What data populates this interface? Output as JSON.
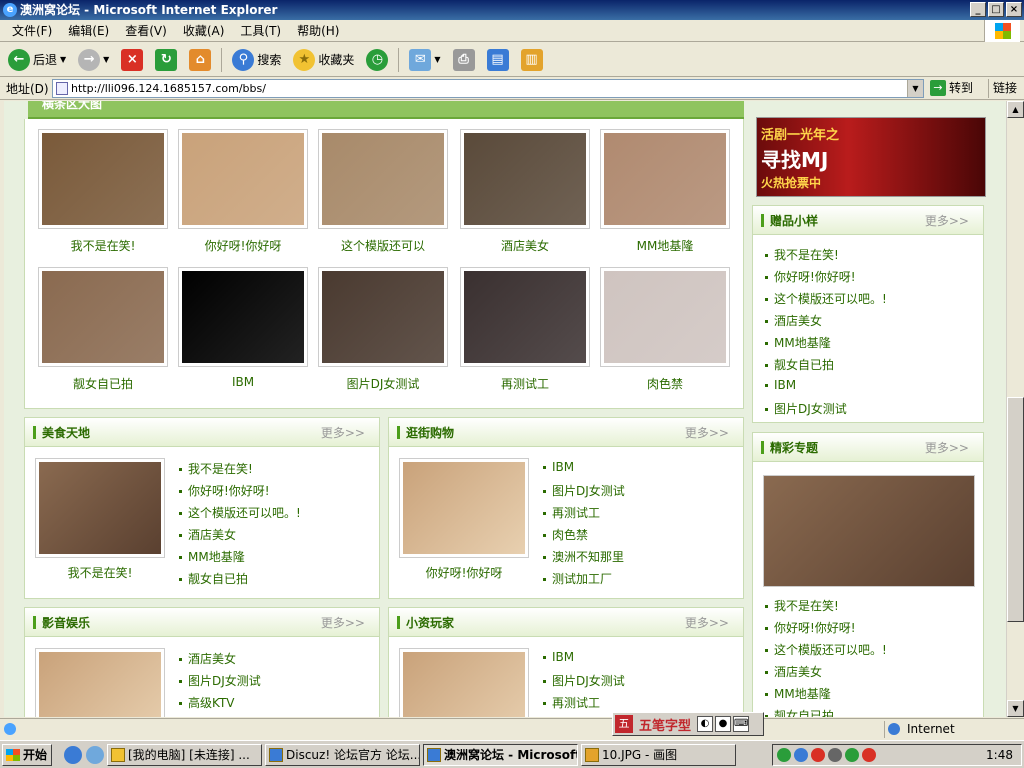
{
  "window": {
    "title": "澳洲窝论坛 - Microsoft Internet Explorer",
    "menu": [
      "文件(F)",
      "编辑(E)",
      "查看(V)",
      "收藏(A)",
      "工具(T)",
      "帮助(H)"
    ],
    "toolbar": {
      "back": "后退",
      "search": "搜索",
      "favorites": "收藏夹"
    },
    "address_label": "地址(D)",
    "address": "http://lli096.124.1685157.com/bbs/",
    "go": "转到",
    "links": "链接"
  },
  "page": {
    "top_strip": "横条区大图",
    "gallery": [
      {
        "caption": "我不是在笑!",
        "color": "#7a5a3a"
      },
      {
        "caption": "你好呀!你好呀",
        "color": "#c9a27a"
      },
      {
        "caption": "这个模版还可以",
        "color": "#a88a6a"
      },
      {
        "caption": "酒店美女",
        "color": "#5a4a3a"
      },
      {
        "caption": "MM地基隆",
        "color": "#b08a70"
      },
      {
        "caption": "靓女自已拍",
        "color": "#8a6a50"
      },
      {
        "caption": "IBM",
        "color": "#000000"
      },
      {
        "caption": "图片DJ女测试",
        "color": "#4a3a30"
      },
      {
        "caption": "再测试工",
        "color": "#3a3030"
      },
      {
        "caption": "肉色禁",
        "color": "#cfc4c0"
      }
    ],
    "food": {
      "title": "美食天地",
      "more": "更多>>",
      "photo_caption": "我不是在笑!",
      "items": [
        "我不是在笑!",
        "你好呀!你好呀!",
        "这个模版还可以吧。!",
        "酒店美女",
        "MM地基隆",
        "靓女自已拍"
      ]
    },
    "shopping": {
      "title": "逛街购物",
      "more": "更多>>",
      "photo_caption": "你好呀!你好呀",
      "items": [
        "IBM",
        "图片DJ女测试",
        "再测试工",
        "肉色禁",
        "澳洲不知那里",
        "测试加工厂"
      ]
    },
    "media": {
      "title": "影音娱乐",
      "more": "更多>>",
      "items": [
        "酒店美女",
        "图片DJ女测试",
        "高级KTV"
      ]
    },
    "petty": {
      "title": "小资玩家",
      "more": "更多>>",
      "items": [
        "IBM",
        "图片DJ女测试",
        "再测试工"
      ]
    },
    "banner": {
      "line1": "活剧一光年之",
      "line2": "寻找MJ",
      "line3": "火热抢票中"
    },
    "gifts": {
      "title": "赠品小样",
      "more": "更多>>",
      "items": [
        "我不是在笑!",
        "你好呀!你好呀!",
        "这个模版还可以吧。!",
        "酒店美女",
        "MM地基隆",
        "靓女自已拍",
        "IBM",
        "图片DJ女测试"
      ]
    },
    "topics": {
      "title": "精彩专题",
      "more": "更多>>",
      "items": [
        "我不是在笑!",
        "你好呀!你好呀!",
        "这个模版还可以吧。!",
        "酒店美女",
        "MM地基隆",
        "靓女自已拍"
      ]
    }
  },
  "statusbar": {
    "zone": "Internet"
  },
  "ime": {
    "label": "五笔字型"
  },
  "taskbar": {
    "start": "开始",
    "tasks": [
      "[我的电脑] [未连接] ...",
      "Discuz! 论坛官方 论坛...",
      "澳洲窝论坛 - Microsoft...",
      "10.JPG - 画图"
    ],
    "clock": "1:48"
  }
}
